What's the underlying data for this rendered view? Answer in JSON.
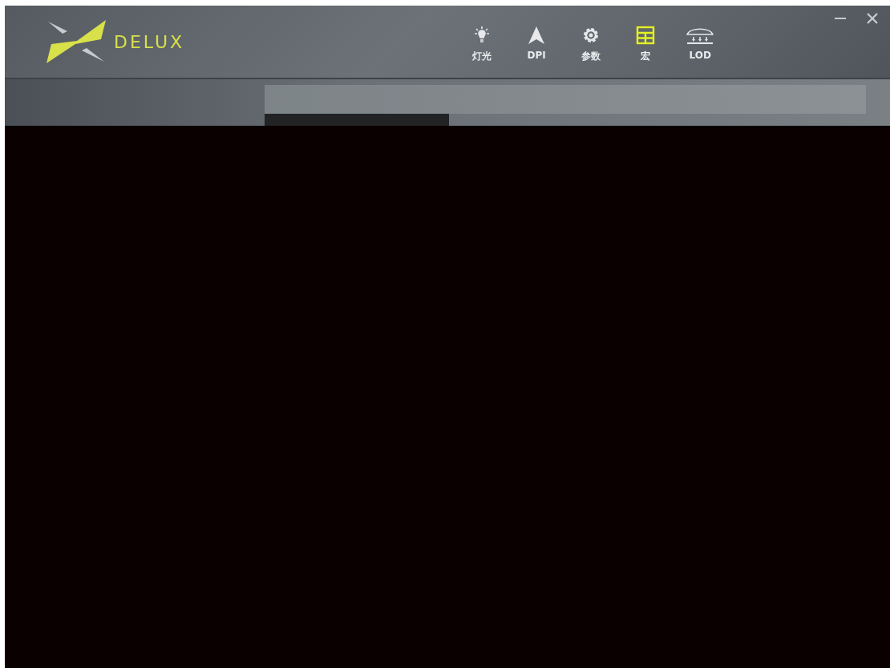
{
  "window": {
    "brand": "DELUX"
  },
  "tabs": [
    {
      "label": "灯光",
      "kind": "light",
      "selected": false
    },
    {
      "label": "DPI",
      "kind": "dpi",
      "selected": false
    },
    {
      "label": "参数",
      "kind": "params",
      "selected": false
    },
    {
      "label": "宏",
      "kind": "macro",
      "selected": true
    },
    {
      "label": "LOD",
      "kind": "lod",
      "selected": false
    }
  ],
  "window_controls": [
    {
      "kind": "minimize"
    },
    {
      "kind": "close"
    }
  ]
}
